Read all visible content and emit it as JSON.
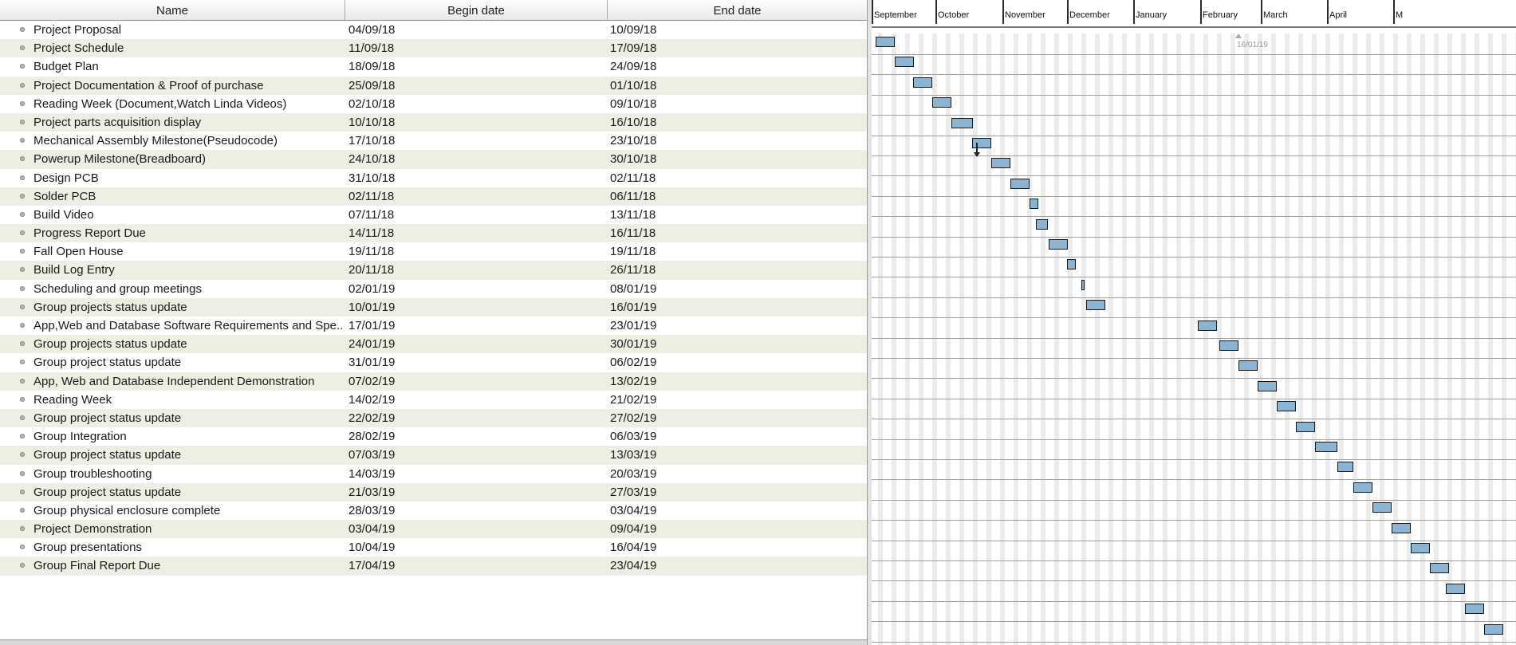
{
  "table": {
    "columns": {
      "name": "Name",
      "begin": "Begin date",
      "end": "End date"
    },
    "rows": [
      {
        "name": "Project Proposal",
        "begin": "04/09/18",
        "end": "10/09/18"
      },
      {
        "name": "Project Schedule",
        "begin": "11/09/18",
        "end": "17/09/18"
      },
      {
        "name": "Budget Plan",
        "begin": "18/09/18",
        "end": "24/09/18"
      },
      {
        "name": "Project Documentation & Proof of purchase",
        "begin": "25/09/18",
        "end": "01/10/18"
      },
      {
        "name": "Reading Week (Document,Watch Linda Videos)",
        "begin": "02/10/18",
        "end": "09/10/18"
      },
      {
        "name": "Project parts acquisition display",
        "begin": "10/10/18",
        "end": "16/10/18"
      },
      {
        "name": "Mechanical Assembly Milestone(Pseudocode)",
        "begin": "17/10/18",
        "end": "23/10/18"
      },
      {
        "name": "Powerup Milestone(Breadboard)",
        "begin": "24/10/18",
        "end": "30/10/18"
      },
      {
        "name": "Design PCB",
        "begin": "31/10/18",
        "end": "02/11/18"
      },
      {
        "name": "Solder PCB",
        "begin": "02/11/18",
        "end": "06/11/18"
      },
      {
        "name": "Build Video",
        "begin": "07/11/18",
        "end": "13/11/18"
      },
      {
        "name": "Progress Report Due",
        "begin": "14/11/18",
        "end": "16/11/18"
      },
      {
        "name": "Fall Open House",
        "begin": "19/11/18",
        "end": "19/11/18"
      },
      {
        "name": "Build Log Entry",
        "begin": "20/11/18",
        "end": "26/11/18"
      },
      {
        "name": "Scheduling and group meetings",
        "begin": "02/01/19",
        "end": "08/01/19"
      },
      {
        "name": "Group projects status update",
        "begin": "10/01/19",
        "end": "16/01/19"
      },
      {
        "name": "App,Web and Database Software Requirements and Spe...",
        "begin": "17/01/19",
        "end": "23/01/19"
      },
      {
        "name": "Group projects status update",
        "begin": "24/01/19",
        "end": "30/01/19"
      },
      {
        "name": "Group project status update",
        "begin": "31/01/19",
        "end": "06/02/19"
      },
      {
        "name": "App, Web and Database Independent Demonstration",
        "begin": "07/02/19",
        "end": "13/02/19"
      },
      {
        "name": "Reading Week",
        "begin": "14/02/19",
        "end": "21/02/19"
      },
      {
        "name": "Group project status update",
        "begin": "22/02/19",
        "end": "27/02/19"
      },
      {
        "name": "Group Integration",
        "begin": "28/02/19",
        "end": "06/03/19"
      },
      {
        "name": "Group project status update",
        "begin": "07/03/19",
        "end": "13/03/19"
      },
      {
        "name": "Group troubleshooting",
        "begin": "14/03/19",
        "end": "20/03/19"
      },
      {
        "name": "Group project status update",
        "begin": "21/03/19",
        "end": "27/03/19"
      },
      {
        "name": "Group physical enclosure complete",
        "begin": "28/03/19",
        "end": "03/04/19"
      },
      {
        "name": "Project Demonstration",
        "begin": "03/04/19",
        "end": "09/04/19"
      },
      {
        "name": "Group presentations",
        "begin": "10/04/19",
        "end": "16/04/19"
      },
      {
        "name": "Group Final Report Due",
        "begin": "17/04/19",
        "end": "23/04/19"
      }
    ]
  },
  "gantt": {
    "months": [
      "September",
      "October",
      "November",
      "December",
      "January",
      "February",
      "March",
      "April",
      "M"
    ],
    "today_label": "16/01/19",
    "bar_color": "#8ab4d1",
    "bars": [
      {
        "start": 5,
        "len": 24
      },
      {
        "start": 29,
        "len": 24
      },
      {
        "start": 52,
        "len": 24
      },
      {
        "start": 76,
        "len": 24
      },
      {
        "start": 100,
        "len": 27
      },
      {
        "start": 126,
        "len": 24
      },
      {
        "start": 150,
        "len": 24
      },
      {
        "start": 174,
        "len": 24
      },
      {
        "start": 198,
        "len": 11
      },
      {
        "start": 206,
        "len": 15
      },
      {
        "start": 222,
        "len": 24
      },
      {
        "start": 245,
        "len": 11
      },
      {
        "start": 263,
        "len": 4
      },
      {
        "start": 269,
        "len": 24
      },
      {
        "start": 409,
        "len": 24
      },
      {
        "start": 436,
        "len": 24
      },
      {
        "start": 460,
        "len": 24
      },
      {
        "start": 484,
        "len": 24
      },
      {
        "start": 508,
        "len": 24
      },
      {
        "start": 532,
        "len": 24
      },
      {
        "start": 556,
        "len": 28
      },
      {
        "start": 584,
        "len": 20
      },
      {
        "start": 604,
        "len": 24
      },
      {
        "start": 628,
        "len": 24
      },
      {
        "start": 652,
        "len": 24
      },
      {
        "start": 676,
        "len": 24
      },
      {
        "start": 700,
        "len": 24
      },
      {
        "start": 720,
        "len": 24
      },
      {
        "start": 744,
        "len": 24
      },
      {
        "start": 768,
        "len": 24
      }
    ]
  }
}
